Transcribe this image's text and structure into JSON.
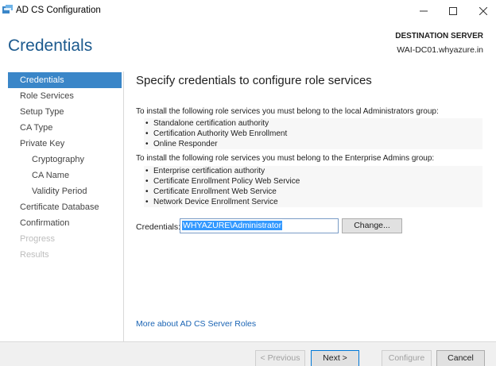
{
  "window": {
    "title": "AD CS Configuration"
  },
  "header": {
    "heading": "Credentials",
    "destination_label": "DESTINATION SERVER",
    "destination_value": "WAI-DC01.whyazure.in"
  },
  "nav": {
    "items": [
      {
        "label": "Credentials",
        "state": "active"
      },
      {
        "label": "Role Services",
        "state": "normal"
      },
      {
        "label": "Setup Type",
        "state": "normal"
      },
      {
        "label": "CA Type",
        "state": "normal"
      },
      {
        "label": "Private Key",
        "state": "normal"
      },
      {
        "label": "Cryptography",
        "state": "sub"
      },
      {
        "label": "CA Name",
        "state": "sub"
      },
      {
        "label": "Validity Period",
        "state": "sub"
      },
      {
        "label": "Certificate Database",
        "state": "normal"
      },
      {
        "label": "Confirmation",
        "state": "normal"
      },
      {
        "label": "Progress",
        "state": "disabled"
      },
      {
        "label": "Results",
        "state": "disabled"
      }
    ]
  },
  "main": {
    "title": "Specify credentials to configure role services",
    "local_admin_intro": "To install the following role services you must belong to the local Administrators group:",
    "local_admin_roles": [
      "Standalone certification authority",
      "Certification Authority Web Enrollment",
      "Online Responder"
    ],
    "enterprise_admin_intro": "To install the following role services you must belong to the Enterprise Admins group:",
    "enterprise_admin_roles": [
      "Enterprise certification authority",
      "Certificate Enrollment Policy Web Service",
      "Certificate Enrollment Web Service",
      "Network Device Enrollment Service"
    ],
    "credentials_label": "Credentials:",
    "credentials_value": "WHYAZURE\\Administrator",
    "change_button": "Change...",
    "more_link": "More about AD CS Server Roles"
  },
  "footer": {
    "previous": "< Previous",
    "next": "Next >",
    "configure": "Configure",
    "cancel": "Cancel"
  },
  "colors": {
    "accent": "#3a86c8",
    "heading": "#1c5a8e",
    "link": "#1a64b4"
  }
}
